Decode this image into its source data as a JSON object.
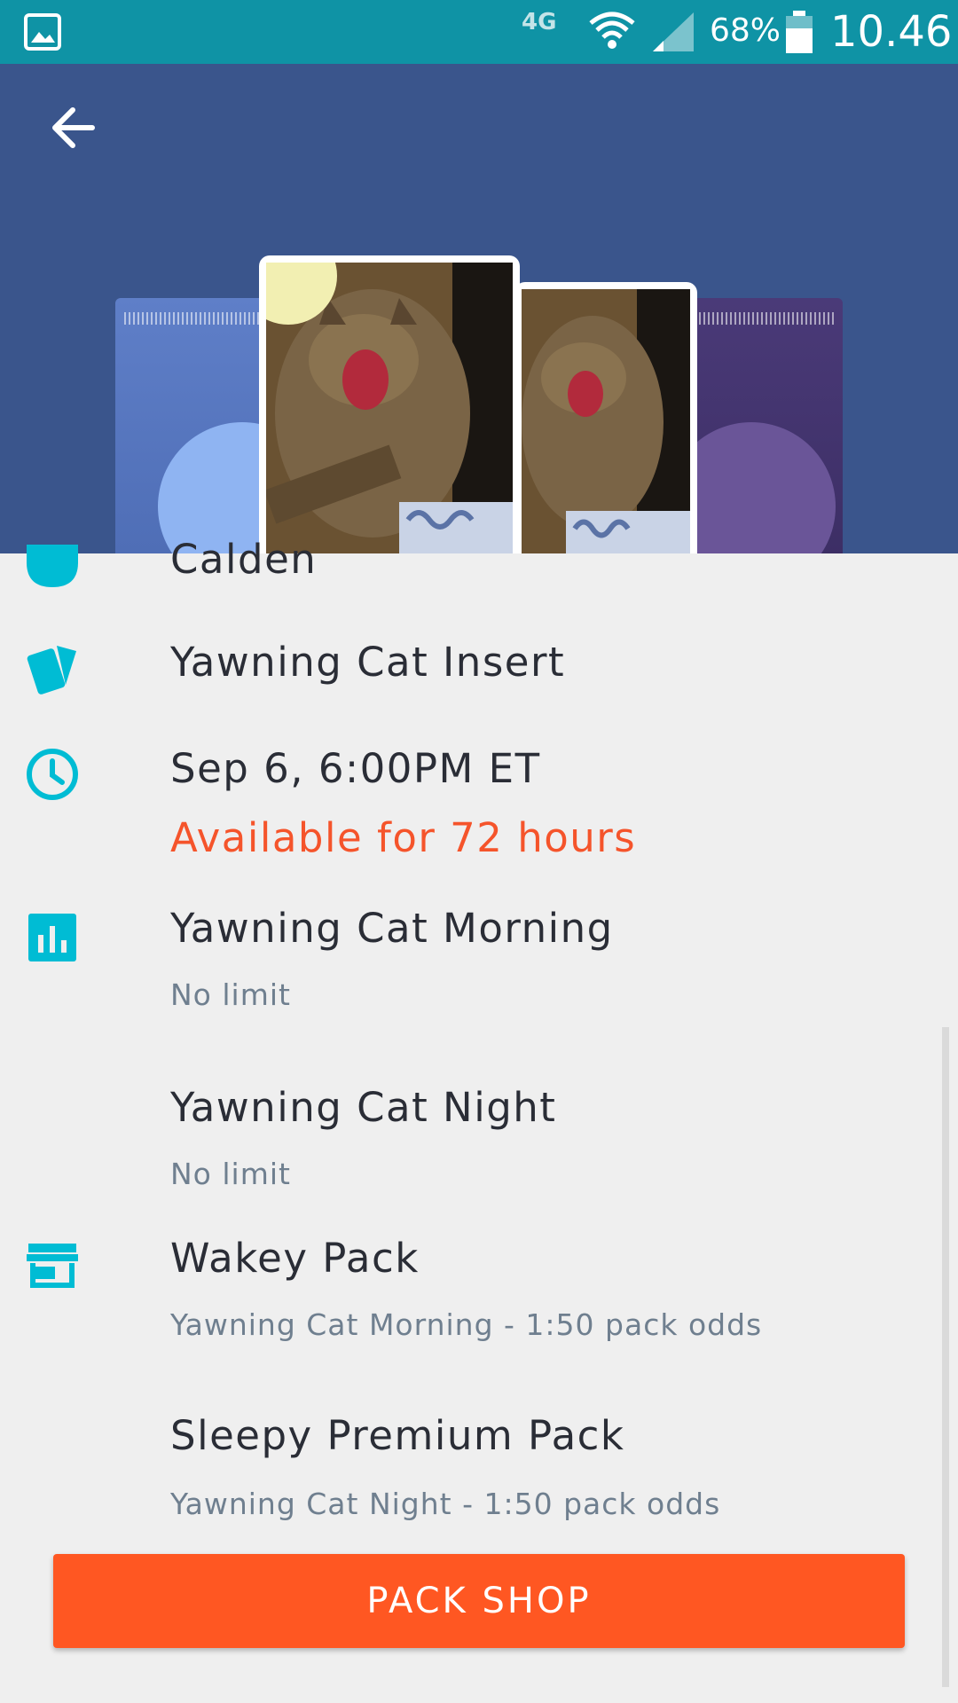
{
  "status_bar": {
    "network": "4G",
    "battery_pct": "68%",
    "time": "10.46"
  },
  "header": {
    "back_icon": "arrow-left-icon"
  },
  "details": {
    "artist_partial": "Calden",
    "card_name": "Yawning Cat Insert",
    "release_time": "Sep 6, 6:00PM ET",
    "availability": "Available for 72 hours",
    "variants": [
      {
        "name": "Yawning Cat Morning",
        "limit": "No limit"
      },
      {
        "name": "Yawning Cat Night",
        "limit": "No limit"
      }
    ],
    "packs": [
      {
        "name": "Wakey Pack",
        "odds": "Yawning Cat Morning - 1:50 pack odds"
      },
      {
        "name": "Sleepy Premium Pack",
        "odds": "Yawning Cat Night - 1:50 pack odds"
      }
    ]
  },
  "cta": {
    "label": "PACK SHOP"
  },
  "colors": {
    "accent_teal": "#00bcd4",
    "status_bar": "#0f93a5",
    "header_bg": "#3a558c",
    "cta_orange": "#ff5722",
    "availability_text": "#f5542b"
  }
}
